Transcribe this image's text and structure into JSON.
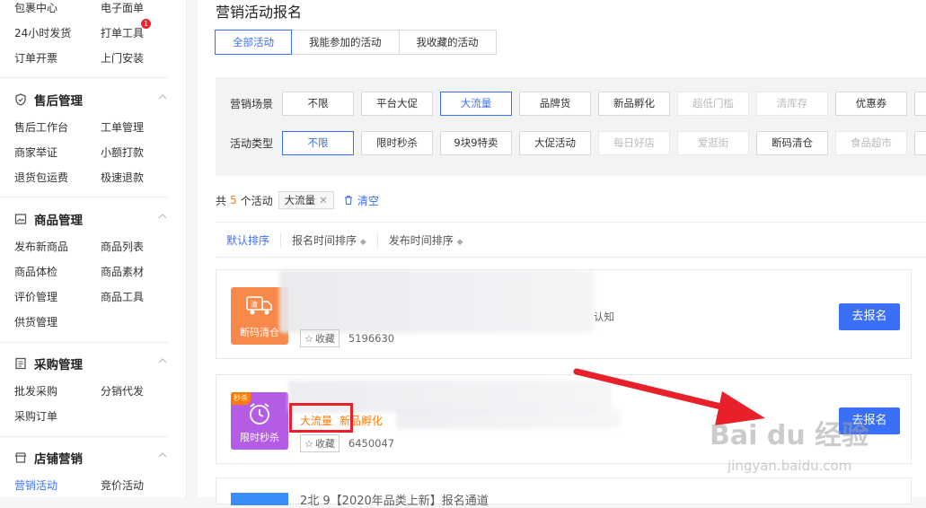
{
  "sidebar": {
    "top_items": [
      [
        "包裹中心",
        "电子面单"
      ],
      [
        "24小时发货",
        "打单工具"
      ],
      [
        "订单开票",
        "上门安装"
      ]
    ],
    "badge": "1",
    "sections": [
      {
        "title": "售后管理",
        "items": [
          [
            "售后工作台",
            "工单管理"
          ],
          [
            "商家举证",
            "小额打款"
          ],
          [
            "退货包运费",
            "极速退款"
          ]
        ]
      },
      {
        "title": "商品管理",
        "items": [
          [
            "发布新商品",
            "商品列表"
          ],
          [
            "商品体检",
            "商品素材"
          ],
          [
            "评价管理",
            "商品工具"
          ],
          [
            "供货管理",
            ""
          ]
        ]
      },
      {
        "title": "采购管理",
        "items": [
          [
            "批发采购",
            "分销代发"
          ],
          [
            "采购订单",
            ""
          ]
        ]
      },
      {
        "title": "店铺营销",
        "items": [
          [
            "营销活动",
            "竞价活动"
          ]
        ]
      }
    ]
  },
  "main": {
    "title": "营销活动报名",
    "tabs": [
      "全部活动",
      "我能参加的活动",
      "我收藏的活动"
    ],
    "filters": {
      "scene_label": "营销场景",
      "scene_options": [
        "不限",
        "平台大促",
        "大流量",
        "品牌货",
        "新品孵化",
        "超低门槛",
        "清库存",
        "优惠券"
      ],
      "type_label": "活动类型",
      "type_options": [
        "不限",
        "限时秒杀",
        "9块9特卖",
        "大促活动",
        "每日好店",
        "爱逛街",
        "断码清仓",
        "食品超市"
      ]
    },
    "result": {
      "prefix": "共",
      "count": "5",
      "suffix": "个活动",
      "tag": "大流量",
      "clear_label": "清空"
    },
    "sort": [
      "默认排序",
      "报名时间排序",
      "发布时间排序"
    ],
    "cards": [
      {
        "thumb_label": "断码清仓",
        "thumb_icon_text": "清",
        "tail_text": "认知",
        "fav_label": "收藏",
        "id": "5196630",
        "button": "去报名"
      },
      {
        "thumb_label": "限时秒杀",
        "corner": "秒杀",
        "tags": [
          "大流量",
          "新品孵化"
        ],
        "fav_label": "收藏",
        "id": "6450047",
        "button": "去报名"
      }
    ],
    "bottom_card_text": "2北 9【2020年品类上新】报名通道"
  },
  "watermark": {
    "brand": "Bai du 经验",
    "url": "jingyan.baidu.com"
  },
  "colors": {
    "accent": "#3a6ff7",
    "orange": "#ff7a00",
    "annotation_red": "#e8202a",
    "qing_thumb": "#f7894a",
    "miaosha_thumb": "#b45ce6"
  }
}
